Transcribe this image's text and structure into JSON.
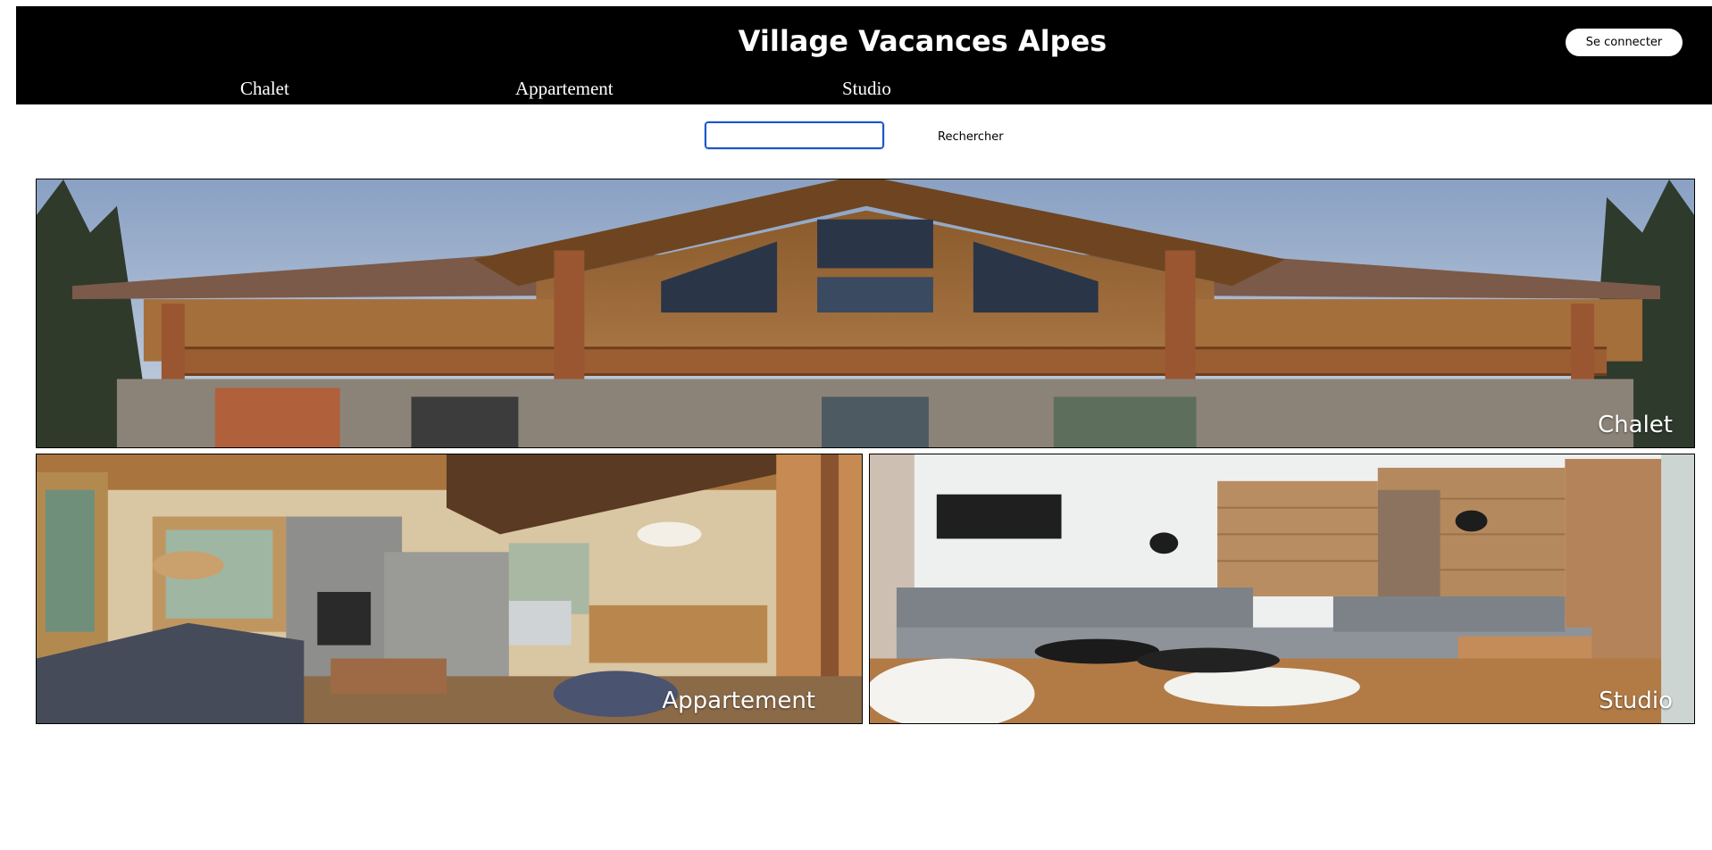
{
  "header": {
    "title": "Village Vacances Alpes",
    "login_label": "Se connecter",
    "nav": [
      "Chalet",
      "Appartement",
      "Studio"
    ]
  },
  "search": {
    "value": "",
    "placeholder": "",
    "button_label": "Rechercher"
  },
  "cards": {
    "chalet": {
      "label": "Chalet"
    },
    "appartement": {
      "label": "Appartement"
    },
    "studio": {
      "label": "Studio"
    }
  },
  "colors": {
    "header_bg": "#000000",
    "header_text": "#ffffff",
    "search_focus": "#1a56c9"
  }
}
